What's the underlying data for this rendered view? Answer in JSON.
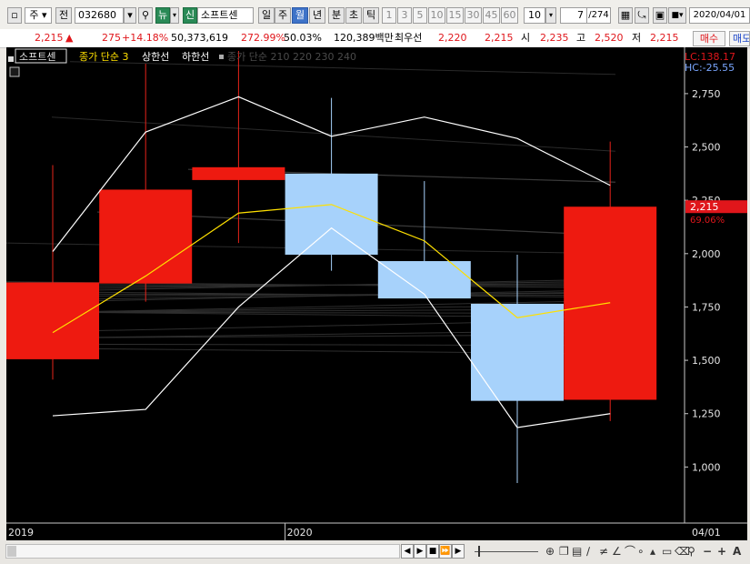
{
  "toolbar": {
    "period_select": "주",
    "prev_label": "전",
    "stock_code": "032680",
    "new_badge": "뉴",
    "credit_badge": "신",
    "stock_name": "소프트센",
    "period_tabs": [
      {
        "label": "일",
        "active": false
      },
      {
        "label": "주",
        "active": false
      },
      {
        "label": "월",
        "active": true
      },
      {
        "label": "년",
        "active": false
      },
      {
        "label": "분",
        "active": false
      },
      {
        "label": "초",
        "active": false
      },
      {
        "label": "틱",
        "active": false
      }
    ],
    "intervals": [
      "1",
      "3",
      "5",
      "10",
      "15",
      "30",
      "45",
      "60"
    ],
    "interval_value": "10",
    "page_position": "7",
    "page_total": "/274",
    "date_value": "2020/04/01"
  },
  "quote": {
    "price": "2,215",
    "arrow": "▲",
    "change": "275",
    "change_pct": "+14.18%",
    "volume": "50,373,619",
    "volume_ratio": "272.99%",
    "turnover_pct": "50.03%",
    "amount": "120,389백만",
    "best_label": "최우선",
    "best_ask": "2,220",
    "best_bid": "2,215",
    "open_label": "시",
    "open": "2,235",
    "high_label": "고",
    "high": "2,520",
    "low_label": "저",
    "low": "2,215",
    "buy_label": "매수",
    "sell_label": "매도"
  },
  "legend": {
    "stock_name": "소프트센",
    "ma_label": "종가 단순 3",
    "upper_label": "상한선",
    "lower_label": "하한선",
    "extra_label": "종가 단순 210 220 230 240",
    "lc": "LC:138.17",
    "hc": "HC:-25.55"
  },
  "price_marker": {
    "value": "2,215",
    "pct": "69.06%"
  },
  "colors": {
    "up": "#ee1a10",
    "down": "#a7d2fb",
    "ma": "#ffe000",
    "band": "#ffffff",
    "marker": "#e0161b"
  },
  "chart_data": {
    "type": "candlestick",
    "x_labels": [
      "2019",
      "2020",
      "04/01"
    ],
    "y_ticks": [
      1000,
      1250,
      1500,
      1750,
      2000,
      2250,
      2500,
      2750
    ],
    "y_range": [
      750,
      2950
    ],
    "candles": [
      {
        "o": 1505,
        "h": 2415,
        "l": 1410,
        "c": 1865
      },
      {
        "o": 1860,
        "h": 2890,
        "l": 1775,
        "c": 2300
      },
      {
        "o": 2345,
        "h": 2950,
        "l": 2050,
        "c": 2405
      },
      {
        "o": 2375,
        "h": 2730,
        "l": 1920,
        "c": 1995
      },
      {
        "o": 1965,
        "h": 2340,
        "l": 1795,
        "c": 1790
      },
      {
        "o": 1765,
        "h": 1995,
        "l": 925,
        "c": 1310
      },
      {
        "o": 1315,
        "h": 2525,
        "l": 1215,
        "c": 2220
      }
    ],
    "ma3": [
      1630,
      1895,
      2190,
      2230,
      2060,
      1700,
      1770
    ],
    "upper_band": [
      2010,
      2570,
      2735,
      2550,
      2640,
      2540,
      2320
    ],
    "lower_band": [
      1240,
      1270,
      1750,
      2120,
      1810,
      1185,
      1250
    ]
  }
}
